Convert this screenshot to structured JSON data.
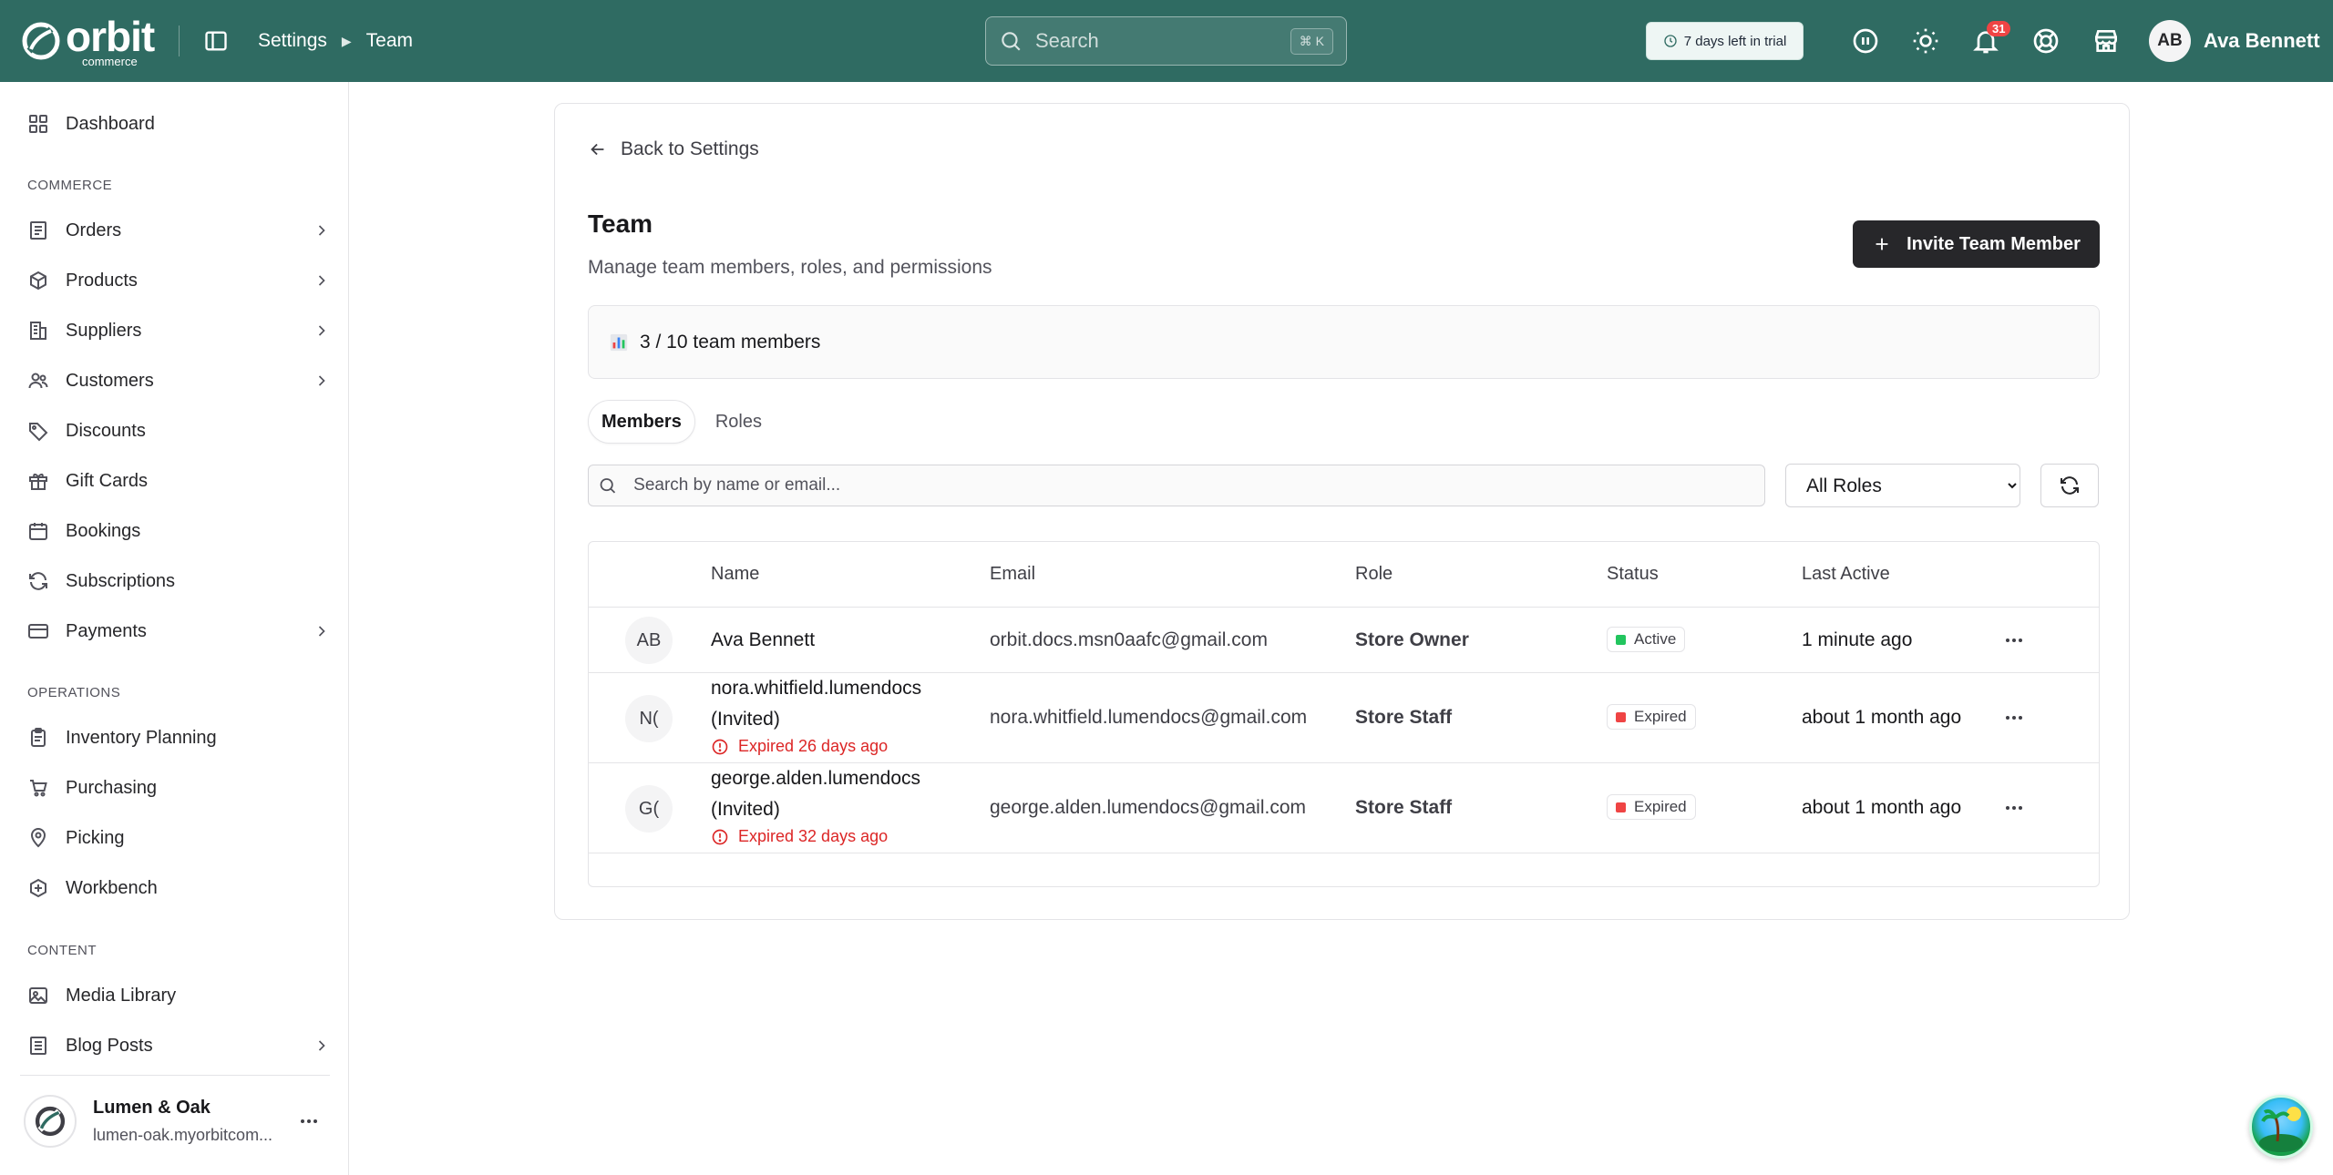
{
  "app": {
    "brand": "orbit",
    "brand_sub": "commerce"
  },
  "breadcrumb": {
    "items": [
      "Settings",
      "Team"
    ]
  },
  "search": {
    "placeholder": "Search",
    "shortcut": "⌘ K"
  },
  "trial": {
    "label": "7 days left in trial"
  },
  "header": {
    "notification_count": "31",
    "icons": [
      "info-circle-icon",
      "sun-icon",
      "bell-icon",
      "lifebuoy-icon",
      "store-icon"
    ]
  },
  "user": {
    "initials": "AB",
    "name": "Ava Bennett"
  },
  "sidebar": {
    "sections": {
      "commerce": "COMMERCE",
      "operations": "OPERATIONS",
      "content": "CONTENT"
    },
    "items": [
      {
        "label": "Dashboard",
        "icon": "dashboard-icon",
        "chevron": false
      },
      {
        "label": "Orders",
        "icon": "orders-icon",
        "chevron": true
      },
      {
        "label": "Products",
        "icon": "box-icon",
        "chevron": true
      },
      {
        "label": "Suppliers",
        "icon": "building-icon",
        "chevron": true
      },
      {
        "label": "Customers",
        "icon": "users-icon",
        "chevron": true
      },
      {
        "label": "Discounts",
        "icon": "tag-icon",
        "chevron": false
      },
      {
        "label": "Gift Cards",
        "icon": "gift-icon",
        "chevron": false
      },
      {
        "label": "Bookings",
        "icon": "calendar-icon",
        "chevron": false
      },
      {
        "label": "Subscriptions",
        "icon": "refresh-icon",
        "chevron": false
      },
      {
        "label": "Payments",
        "icon": "credit-card-icon",
        "chevron": true
      },
      {
        "label": "Inventory Planning",
        "icon": "clipboard-icon",
        "chevron": false
      },
      {
        "label": "Purchasing",
        "icon": "cart-icon",
        "chevron": false
      },
      {
        "label": "Picking",
        "icon": "map-pin-icon",
        "chevron": false
      },
      {
        "label": "Workbench",
        "icon": "wrench-icon",
        "chevron": false
      },
      {
        "label": "Media Library",
        "icon": "image-icon",
        "chevron": false
      },
      {
        "label": "Blog Posts",
        "icon": "document-icon",
        "chevron": true
      }
    ],
    "store": {
      "name": "Lumen & Oak",
      "url": "lumen-oak.myorbitcom..."
    }
  },
  "page": {
    "back_label": "Back to Settings",
    "title": "Team",
    "subtitle": "Manage team members, roles, and permissions",
    "invite_label": "Invite Team Member",
    "members_count": "3 / 10 team members",
    "tabs": [
      {
        "label": "Members",
        "active": true
      },
      {
        "label": "Roles",
        "active": false
      }
    ],
    "member_search_placeholder": "Search by name or email...",
    "role_filter": {
      "selected": "All Roles",
      "options": [
        "All Roles"
      ]
    }
  },
  "table": {
    "columns": [
      "Name",
      "Email",
      "Role",
      "Status",
      "Last Active"
    ],
    "rows": [
      {
        "initials": "AB",
        "name": "Ava Bennett",
        "name_line2": "",
        "expired_note": "",
        "email": "orbit.docs.msn0aafc@gmail.com",
        "role": "Store Owner",
        "status": "Active",
        "status_color": "#22c55e",
        "last_active": "1 minute ago"
      },
      {
        "initials": "N(",
        "name": "nora.whitfield.lumendocs",
        "name_line2": "(Invited)",
        "expired_note": "Expired 26 days ago",
        "email": "nora.whitfield.lumendocs@gmail.com",
        "role": "Store Staff",
        "status": "Expired",
        "status_color": "#ef4444",
        "last_active": "about 1 month ago"
      },
      {
        "initials": "G(",
        "name": "george.alden.lumendocs",
        "name_line2": "(Invited)",
        "expired_note": "Expired 32 days ago",
        "email": "george.alden.lumendocs@gmail.com",
        "role": "Store Staff",
        "status": "Expired",
        "status_color": "#ef4444",
        "last_active": "about 1 month ago"
      }
    ]
  },
  "colors": {
    "topbar": "#2f6b62",
    "primary_button": "#27272a",
    "danger": "#dc2626"
  }
}
